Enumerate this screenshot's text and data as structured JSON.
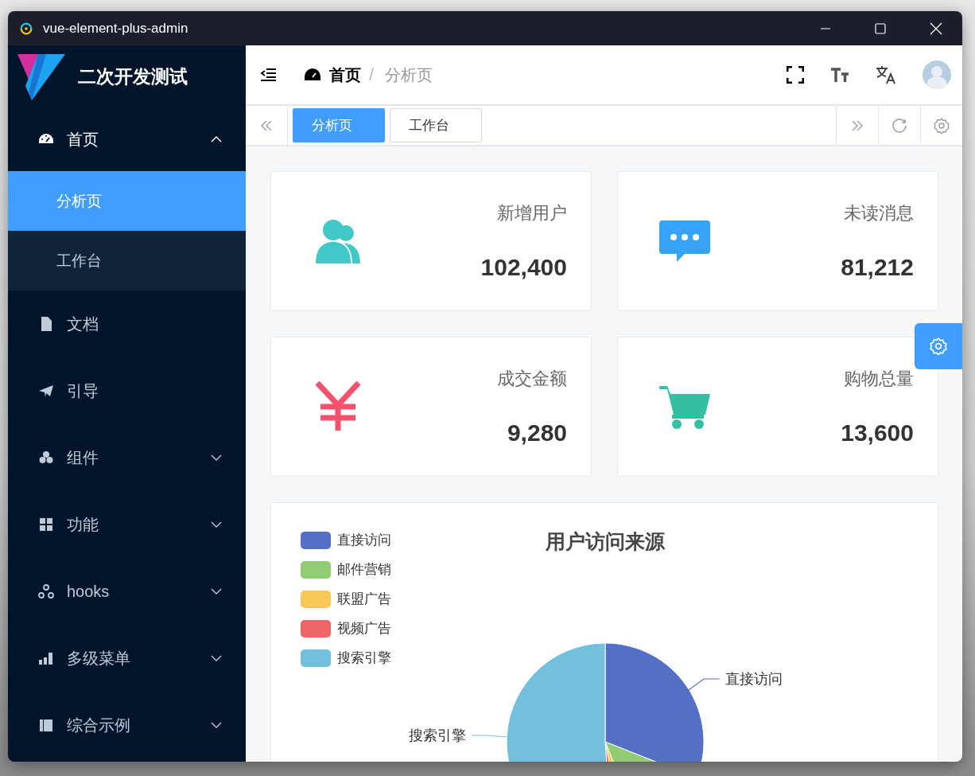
{
  "window": {
    "title": "vue-element-plus-admin"
  },
  "sidebar": {
    "title": "二次开发测试",
    "items": [
      {
        "label": "首页",
        "kind": "group",
        "expanded": true,
        "children": [
          {
            "label": "分析页",
            "selected": true
          },
          {
            "label": "工作台",
            "selected": false
          }
        ]
      },
      {
        "label": "文档",
        "kind": "link"
      },
      {
        "label": "引导",
        "kind": "link"
      },
      {
        "label": "组件",
        "kind": "group",
        "expanded": false
      },
      {
        "label": "功能",
        "kind": "group",
        "expanded": false
      },
      {
        "label": "hooks",
        "kind": "group",
        "expanded": false
      },
      {
        "label": "多级菜单",
        "kind": "group",
        "expanded": false
      },
      {
        "label": "综合示例",
        "kind": "group",
        "expanded": false
      }
    ]
  },
  "breadcrumb": [
    "首页",
    "分析页"
  ],
  "breadcrumb_separator": "/",
  "tabs": [
    {
      "label": "分析页",
      "selected": true
    },
    {
      "label": "工作台",
      "selected": false
    }
  ],
  "stats": [
    {
      "title": "新增用户",
      "value": "102,400",
      "color": "#40c9c6"
    },
    {
      "title": "未读消息",
      "value": "81,212",
      "color": "#36a3f7"
    },
    {
      "title": "成交金额",
      "value": "9,280",
      "color": "#f4516c"
    },
    {
      "title": "购物总量",
      "value": "13,600",
      "color": "#34bfa3"
    }
  ],
  "chart": {
    "title": "用户访问来源",
    "legend": [
      {
        "label": "直接访问",
        "color": "#5470c6"
      },
      {
        "label": "邮件营销",
        "color": "#91cc75"
      },
      {
        "label": "联盟广告",
        "color": "#fac858"
      },
      {
        "label": "视频广告",
        "color": "#ee6666"
      },
      {
        "label": "搜索引擎",
        "color": "#73c0de"
      }
    ],
    "slice_labels": [
      {
        "label": "直接访问"
      },
      {
        "label": "搜索引擎"
      }
    ]
  }
}
